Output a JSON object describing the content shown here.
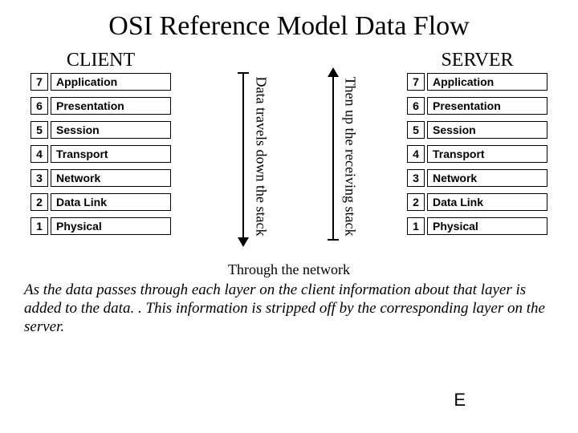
{
  "title": "OSI Reference Model Data Flow",
  "client_title": "CLIENT",
  "server_title": "SERVER",
  "layers": [
    {
      "num": "7",
      "name": "Application"
    },
    {
      "num": "6",
      "name": "Presentation"
    },
    {
      "num": "5",
      "name": "Session"
    },
    {
      "num": "4",
      "name": "Transport"
    },
    {
      "num": "3",
      "name": "Network"
    },
    {
      "num": "2",
      "name": "Data Link"
    },
    {
      "num": "1",
      "name": "Physical"
    }
  ],
  "down_label": "Data travels down the stack",
  "up_label": "Then up the receiving stack",
  "through_label": "Through the network",
  "description": "As the data passes through each layer on the client information about that layer is added to the data. . This information is stripped off by the corresponding layer on the server.",
  "corner_label": "E"
}
